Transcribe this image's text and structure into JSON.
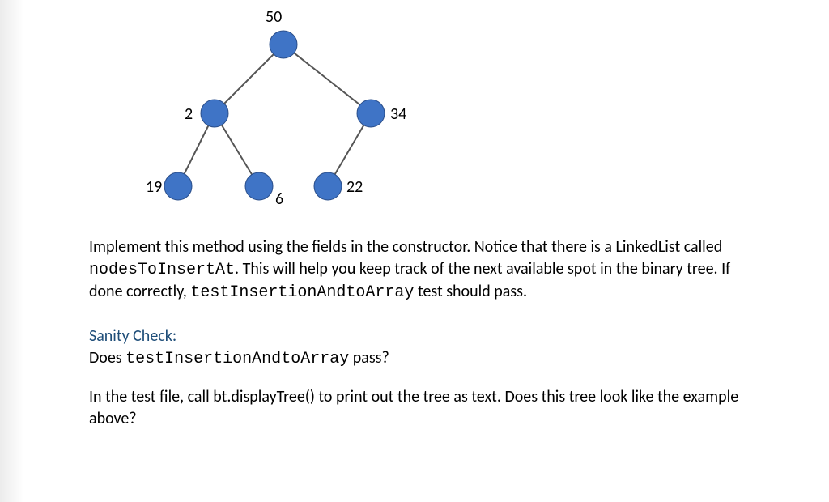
{
  "tree": {
    "nodes": {
      "root": {
        "label": "50"
      },
      "left": {
        "label": "2"
      },
      "right": {
        "label": "34"
      },
      "ll": {
        "label": "19"
      },
      "lr": {
        "label": "6"
      },
      "rl": {
        "label": "22"
      }
    }
  },
  "body": {
    "p1_pre": "Implement this method using the fields in the constructor. Notice that there is a LinkedList called ",
    "p1_code1": "nodesToInsertAt",
    "p1_mid": ". This will help you keep track of the next available spot in the binary tree. If done correctly, ",
    "p1_code2": "testInsertionAndtoArray",
    "p1_post": " test should pass."
  },
  "sanity": {
    "heading": "Sanity Check:",
    "q1_pre": "Does ",
    "q1_code": "testInsertionAndtoArray",
    "q1_post": " pass?",
    "q2": "In the test file, call bt.displayTree() to print out the tree as text. Does this tree look like the example above?"
  }
}
